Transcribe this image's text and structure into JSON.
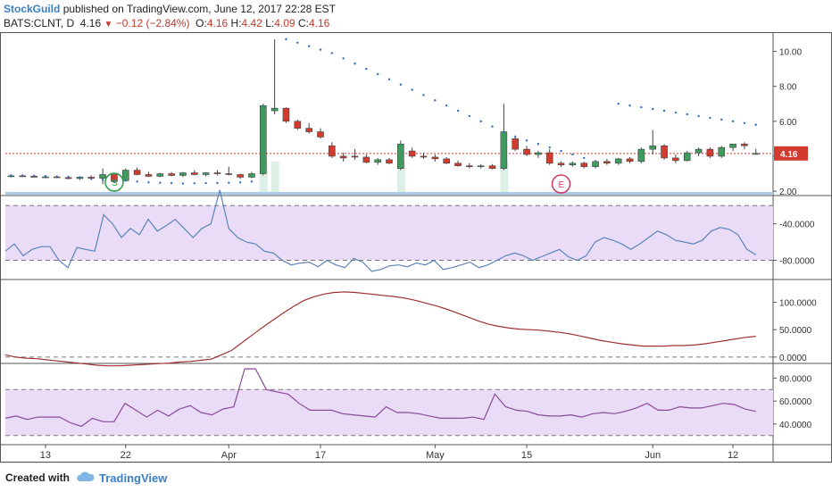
{
  "header": {
    "author": "StockGuild",
    "published": "published on TradingView.com, June 12, 2017 22:28 EST",
    "symbol": "BATS:CLNT, D",
    "last": "4.16",
    "change": "−0.12 (−2.84%)",
    "o_label": "O:",
    "o": "4.16",
    "h_label": "H:",
    "h": "4.42",
    "l_label": "L:",
    "l": "4.09",
    "c_label": "C:",
    "c": "4.16"
  },
  "footer": {
    "created_with": "Created with",
    "brand": "TradingView"
  },
  "colors": {
    "up": "#3f9a5f",
    "down": "#d23b2e",
    "sar": "#2f6dbf",
    "rsi": "#5b84b8",
    "osc": "#a03030",
    "mfi": "#8a4a9a",
    "band": "#eadcf6",
    "last_price": "#d23b2e"
  },
  "chart_data": [
    {
      "type": "candlestick",
      "name": "price",
      "ylim": [
        1.8,
        11.0
      ],
      "y_ticks": [
        "2.00",
        "4.00",
        "6.00",
        "8.00",
        "10.00"
      ],
      "y_tick_values": [
        2,
        4,
        6,
        8,
        10
      ],
      "last_price_label": "4.16",
      "last_price": 4.16,
      "x_tick_labels": [
        "13",
        "22",
        "Apr",
        "17",
        "May",
        "15",
        "Jun",
        "12"
      ],
      "x_tick_index": [
        3,
        10,
        19,
        27,
        37,
        45,
        56,
        63
      ],
      "candles": [
        [
          2.85,
          2.95,
          2.78,
          2.88
        ],
        [
          2.88,
          2.95,
          2.8,
          2.86
        ],
        [
          2.86,
          2.92,
          2.78,
          2.8
        ],
        [
          2.8,
          2.9,
          2.74,
          2.82
        ],
        [
          2.82,
          2.9,
          2.75,
          2.78
        ],
        [
          2.78,
          2.85,
          2.68,
          2.72
        ],
        [
          2.72,
          2.85,
          2.65,
          2.8
        ],
        [
          2.8,
          2.9,
          2.7,
          2.74
        ],
        [
          2.74,
          3.3,
          2.4,
          2.95
        ],
        [
          2.95,
          3.0,
          2.45,
          2.55
        ],
        [
          2.6,
          3.3,
          2.55,
          3.2
        ],
        [
          3.2,
          3.35,
          2.9,
          2.95
        ],
        [
          2.95,
          3.1,
          2.8,
          2.85
        ],
        [
          2.85,
          3.05,
          2.8,
          3.0
        ],
        [
          3.0,
          3.1,
          2.85,
          2.9
        ],
        [
          2.9,
          3.1,
          2.8,
          3.05
        ],
        [
          3.05,
          3.2,
          2.9,
          2.95
        ],
        [
          2.95,
          3.1,
          2.85,
          3.05
        ],
        [
          3.05,
          3.2,
          2.9,
          3.0
        ],
        [
          3.0,
          3.4,
          2.9,
          2.95
        ],
        [
          2.95,
          3.0,
          2.7,
          2.8
        ],
        [
          2.8,
          3.1,
          2.75,
          3.0
        ],
        [
          3.0,
          7.0,
          2.9,
          6.9
        ],
        [
          6.6,
          10.7,
          6.4,
          6.75
        ],
        [
          6.75,
          6.8,
          5.9,
          6.0
        ],
        [
          6.0,
          6.1,
          5.5,
          5.6
        ],
        [
          5.6,
          5.9,
          5.3,
          5.4
        ],
        [
          5.4,
          5.6,
          5.0,
          5.1
        ],
        [
          4.6,
          4.8,
          3.9,
          4.0
        ],
        [
          4.0,
          4.2,
          3.7,
          3.9
        ],
        [
          4.0,
          4.4,
          3.8,
          3.95
        ],
        [
          3.95,
          4.1,
          3.6,
          3.65
        ],
        [
          3.65,
          3.9,
          3.5,
          3.8
        ],
        [
          3.8,
          3.9,
          3.55,
          3.6
        ],
        [
          3.3,
          4.9,
          3.2,
          4.7
        ],
        [
          4.3,
          4.5,
          3.9,
          4.0
        ],
        [
          4.0,
          4.2,
          3.85,
          3.95
        ],
        [
          3.95,
          4.1,
          3.7,
          3.85
        ],
        [
          3.85,
          3.95,
          3.55,
          3.6
        ],
        [
          3.6,
          3.75,
          3.4,
          3.45
        ],
        [
          3.45,
          3.6,
          3.3,
          3.4
        ],
        [
          3.4,
          3.55,
          3.3,
          3.45
        ],
        [
          3.45,
          3.55,
          3.25,
          3.3
        ],
        [
          3.3,
          7.0,
          3.2,
          5.4
        ],
        [
          5.0,
          5.2,
          4.3,
          4.4
        ],
        [
          4.4,
          4.6,
          4.0,
          4.1
        ],
        [
          4.1,
          4.3,
          3.9,
          4.2
        ],
        [
          4.2,
          4.4,
          3.5,
          3.6
        ],
        [
          3.6,
          3.7,
          3.4,
          3.5
        ],
        [
          3.5,
          3.7,
          3.4,
          3.6
        ],
        [
          3.6,
          3.7,
          3.3,
          3.4
        ],
        [
          3.4,
          3.8,
          3.3,
          3.7
        ],
        [
          3.7,
          3.85,
          3.5,
          3.6
        ],
        [
          3.6,
          3.9,
          3.5,
          3.85
        ],
        [
          3.85,
          3.95,
          3.6,
          3.7
        ],
        [
          3.7,
          4.5,
          3.6,
          4.4
        ],
        [
          4.4,
          5.5,
          4.1,
          4.6
        ],
        [
          4.6,
          4.7,
          3.8,
          3.9
        ],
        [
          3.9,
          4.1,
          3.6,
          3.75
        ],
        [
          3.75,
          4.3,
          3.7,
          4.2
        ],
        [
          4.2,
          4.5,
          4.0,
          4.4
        ],
        [
          4.4,
          4.5,
          3.9,
          4.0
        ],
        [
          4.0,
          4.6,
          3.9,
          4.5
        ],
        [
          4.5,
          4.7,
          4.3,
          4.7
        ],
        [
          4.7,
          4.8,
          4.4,
          4.6
        ],
        [
          4.16,
          4.42,
          4.09,
          4.16
        ]
      ],
      "sar": [
        2.9,
        2.9,
        2.88,
        2.86,
        2.84,
        2.82,
        2.8,
        2.7,
        2.65,
        2.62,
        2.6,
        2.55,
        2.5,
        2.48,
        2.46,
        2.44,
        2.45,
        2.46,
        2.47,
        2.48,
        2.5,
        2.55,
        null,
        null,
        10.7,
        10.5,
        10.3,
        10.1,
        9.9,
        9.6,
        9.3,
        9.0,
        8.7,
        8.4,
        8.1,
        7.8,
        7.5,
        7.2,
        6.9,
        6.6,
        6.3,
        6.0,
        5.7,
        5.4,
        5.1,
        4.9,
        4.7,
        4.5,
        4.3,
        4.1,
        3.9,
        null,
        null,
        7.0,
        6.9,
        6.8,
        6.7,
        6.6,
        6.5,
        6.4,
        6.3,
        6.2,
        6.1,
        6.0,
        5.9,
        5.8
      ]
    },
    {
      "type": "line",
      "name": "williams-r",
      "ylim": [
        -100,
        -10
      ],
      "y_ticks": [
        "-40.0000",
        "-80.0000"
      ],
      "y_tick_values": [
        -40,
        -80
      ],
      "band": [
        -80,
        -20
      ],
      "values": [
        -70,
        -62,
        -75,
        -68,
        -65,
        -65,
        -80,
        -88,
        -66,
        -68,
        -70,
        -30,
        -40,
        -55,
        -45,
        -52,
        -35,
        -48,
        -42,
        -35,
        -45,
        -55,
        -45,
        -40,
        -3,
        -45,
        -55,
        -60,
        -62,
        -70,
        -72,
        -80,
        -85,
        -83,
        -82,
        -87,
        -80,
        -85,
        -88,
        -78,
        -82,
        -92,
        -90,
        -86,
        -85,
        -87,
        -83,
        -85,
        -80,
        -90,
        -88,
        -85,
        -82,
        -88,
        -85,
        -80,
        -75,
        -72,
        -75,
        -80,
        -76,
        -72,
        -68,
        -76,
        -80,
        -75,
        -60,
        -55,
        -58,
        -62,
        -68,
        -62,
        -55,
        -48,
        -52,
        -58,
        -60,
        -62,
        -58,
        -48,
        -44,
        -46,
        -52,
        -68,
        -74
      ]
    },
    {
      "type": "line",
      "name": "oscillator",
      "ylim": [
        -10,
        140
      ],
      "y_ticks": [
        "100.0000",
        "50.0000",
        "0.0000"
      ],
      "y_tick_values": [
        100,
        50,
        0
      ],
      "values": [
        4,
        0,
        -2,
        -3,
        -5,
        -7,
        -9,
        -11,
        -13,
        -15,
        -16,
        -16,
        -15,
        -14,
        -13,
        -12,
        -11,
        -9,
        -8,
        -6,
        -4,
        4,
        12,
        26,
        40,
        54,
        67,
        80,
        92,
        103,
        110,
        115,
        118,
        119,
        118,
        116,
        114,
        112,
        110,
        107,
        103,
        98,
        93,
        87,
        80,
        73,
        66,
        60,
        56,
        53,
        51,
        50,
        49,
        47,
        45,
        42,
        38,
        34,
        30,
        27,
        24,
        22,
        20,
        20,
        20,
        21,
        21,
        22,
        24,
        27,
        30,
        33,
        36,
        38
      ]
    },
    {
      "type": "line",
      "name": "mfi",
      "ylim": [
        22,
        92
      ],
      "y_ticks": [
        "80.0000",
        "60.0000",
        "40.0000"
      ],
      "y_tick_values": [
        80,
        60,
        40
      ],
      "band": [
        30,
        70
      ],
      "values": [
        45,
        47,
        44,
        46,
        46,
        46,
        41,
        38,
        45,
        42,
        42,
        58,
        52,
        46,
        52,
        47,
        53,
        56,
        50,
        48,
        53,
        55,
        88,
        88,
        70,
        68,
        66,
        58,
        52,
        52,
        52,
        49,
        48,
        47,
        46,
        55,
        50,
        50,
        49,
        47,
        45,
        45,
        45,
        46,
        44,
        66,
        55,
        52,
        51,
        48,
        47,
        47,
        48,
        46,
        49,
        50,
        49,
        51,
        54,
        58,
        52,
        52,
        55,
        54,
        54,
        56,
        58,
        57,
        53,
        51
      ]
    }
  ]
}
